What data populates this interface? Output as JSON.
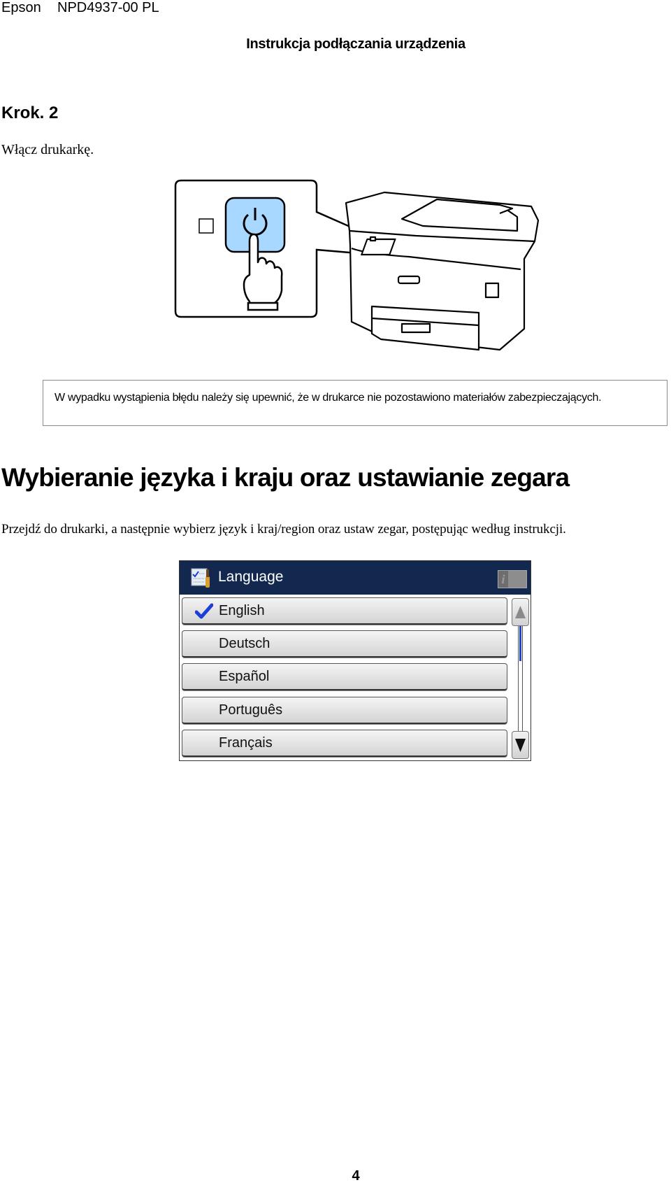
{
  "header": {
    "brand": "Epson",
    "doc_code": "NPD4937-00 PL",
    "title": "Instrukcja podłączania urządzenia"
  },
  "step": {
    "label": "Krok. 2",
    "instruction": "Włącz drukarkę."
  },
  "illustration": {
    "icons": [
      "power-button-icon",
      "pointing-hand-icon",
      "printer-icon",
      "light-indicator-icon"
    ],
    "button_color": "#a8d8ff"
  },
  "note": {
    "text": "W wypadku wystąpienia błędu należy się upewnić, że w drukarce nie pozostawiono materiałów zabezpieczających."
  },
  "section": {
    "heading": "Wybieranie języka i kraju oraz ustawianie zegara",
    "paragraph": "Przejdź do drukarki, a następnie wybierz język i kraj/region oraz ustaw zegar, postępując według instrukcji."
  },
  "lcd_panel": {
    "title": "Language",
    "title_icon": "settings-checklist-icon",
    "info_label": "i",
    "titlebar_color": "#13284f",
    "selected": "English",
    "items": [
      {
        "label": "English",
        "checked": true
      },
      {
        "label": "Deutsch",
        "checked": false
      },
      {
        "label": "Español",
        "checked": false
      },
      {
        "label": "Português",
        "checked": false
      },
      {
        "label": "Français",
        "checked": false
      }
    ],
    "scroll_up_icon": "triangle-up-icon",
    "scroll_down_icon": "triangle-down-icon",
    "scroll_position": 0,
    "scroll_accent": "#2244cc"
  },
  "footer": {
    "page_number": "4"
  }
}
